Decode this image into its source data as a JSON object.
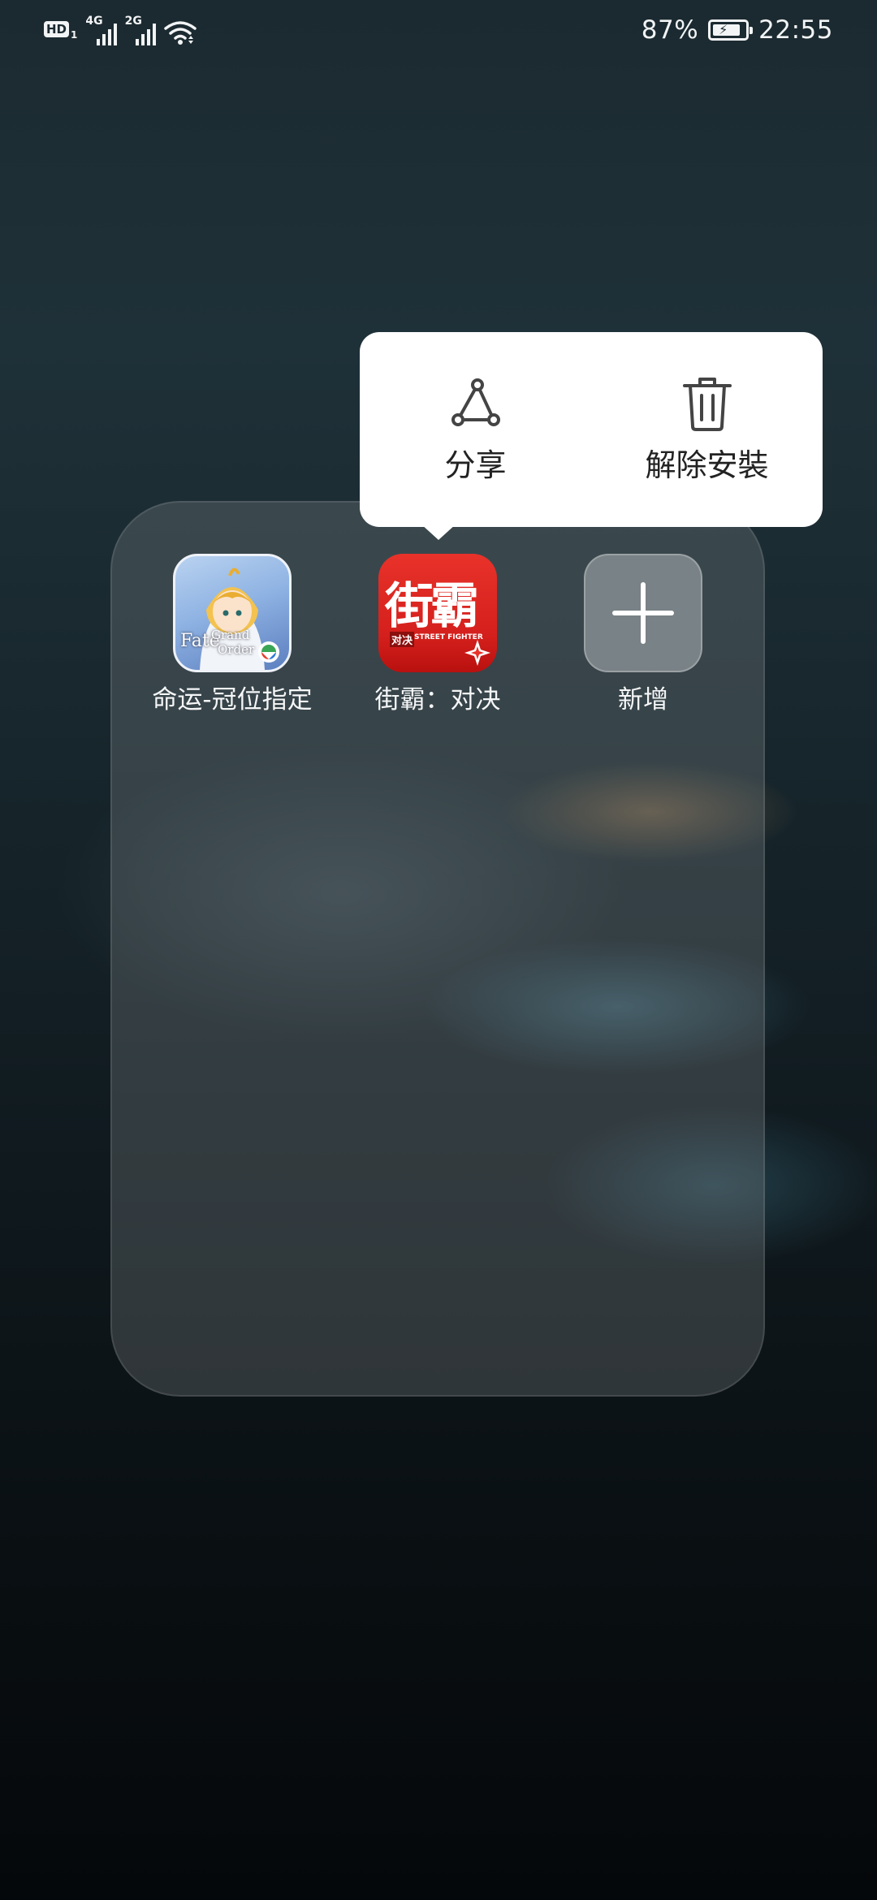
{
  "status_bar": {
    "hd_badge": "HD",
    "hd_sub": "1",
    "network_1": "4G",
    "network_2": "2G",
    "battery_percent": "87%",
    "time": "22:55",
    "battery_level": 0.87,
    "icons": [
      "hd-voice-icon",
      "signal-icon",
      "signal-icon",
      "wifi-icon",
      "battery-charging-icon"
    ]
  },
  "popup_menu": {
    "items": [
      {
        "label": "分享",
        "icon": "share-icon"
      },
      {
        "label": "解除安裝",
        "icon": "trash-icon"
      }
    ]
  },
  "folder": {
    "apps": [
      {
        "label": "命运-冠位指定",
        "icon": "fate-grand-order-app-icon",
        "icon_text": [
          "Fate",
          "Grand",
          "Order"
        ]
      },
      {
        "label": "街霸：对决",
        "icon": "street-fighter-app-icon",
        "icon_text": [
          "街霸",
          "对决",
          "STREET FIGHTER"
        ]
      },
      {
        "label": "新增",
        "icon": "plus-icon"
      }
    ]
  },
  "colors": {
    "popup_bg": "#ffffff",
    "street_fighter_red": "#d41f1c"
  }
}
